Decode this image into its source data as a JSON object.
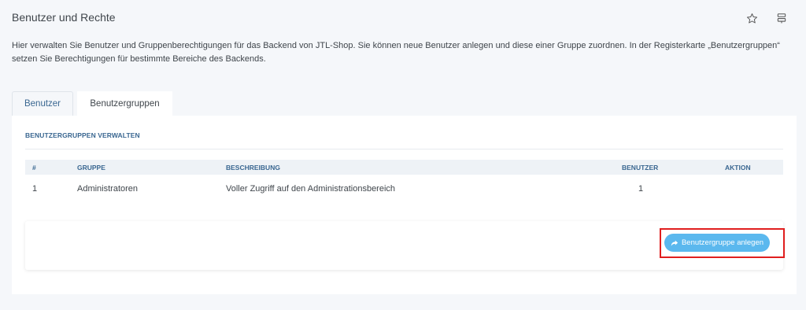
{
  "header": {
    "title": "Benutzer und Rechte",
    "icons": [
      "star-icon",
      "settings-icon"
    ]
  },
  "description": "Hier verwalten Sie Benutzer und Gruppenberechtigungen für das Backend von JTL-Shop. Sie können neue Benutzer anlegen und diese einer Gruppe zuordnen. In der Registerkarte „Benutzergruppen“ setzen Sie Berechtigungen für bestimmte Bereiche des Backends.",
  "tabs": [
    {
      "label": "Benutzer",
      "active": false
    },
    {
      "label": "Benutzergruppen",
      "active": true
    }
  ],
  "section": {
    "heading": "BENUTZERGRUPPEN VERWALTEN"
  },
  "table": {
    "columns": [
      "#",
      "GRUPPE",
      "BESCHREIBUNG",
      "BENUTZER",
      "AKTION"
    ],
    "rows": [
      {
        "num": "1",
        "group": "Administratoren",
        "description": "Voller Zugriff auf den Administrationsbereich",
        "users": "1",
        "action": ""
      }
    ]
  },
  "actions": {
    "add_group_label": "Benutzergruppe anlegen",
    "add_group_icon": "share-icon"
  },
  "colors": {
    "accent": "#3a6791",
    "button": "#5bb8ee",
    "highlight": "#e01e1e"
  }
}
